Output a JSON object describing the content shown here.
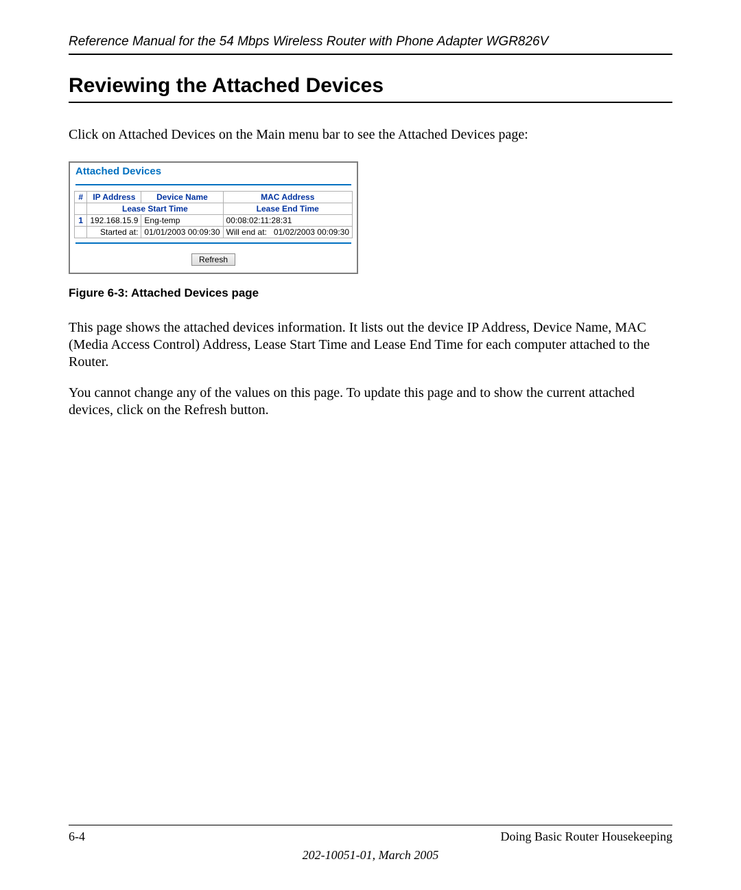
{
  "header": {
    "running": "Reference Manual for the 54 Mbps Wireless Router with Phone Adapter WGR826V"
  },
  "section": {
    "title": "Reviewing the Attached Devices",
    "intro": "Click on Attached Devices on the Main menu bar to see the Attached Devices page:",
    "figure_caption": "Figure 6-3:  Attached Devices page",
    "para1": "This page shows the attached devices information. It lists out the device IP Address, Device Name, MAC (Media Access Control) Address, Lease Start Time and Lease End Time for each computer attached to the Router.",
    "para2": "You cannot change any of the values on this page. To update this page and to show the current attached devices, click on the Refresh button."
  },
  "panel": {
    "title": "Attached Devices",
    "columns": {
      "idx": "#",
      "ip": "IP Address",
      "name": "Device Name",
      "mac": "MAC Address",
      "lease_start": "Lease Start Time",
      "lease_end": "Lease End Time"
    },
    "row": {
      "idx": "1",
      "ip": "192.168.15.9",
      "name": "Eng-temp",
      "mac": "00:08:02:11:28:31",
      "start_label": "Started at:",
      "start_val": "01/01/2003 00:09:30",
      "end_label": "Will end at:",
      "end_val": "01/02/2003 00:09:30"
    },
    "refresh": "Refresh"
  },
  "footer": {
    "page_num": "6-4",
    "chapter": "Doing Basic Router Housekeeping",
    "docid": "202-10051-01, March 2005"
  }
}
